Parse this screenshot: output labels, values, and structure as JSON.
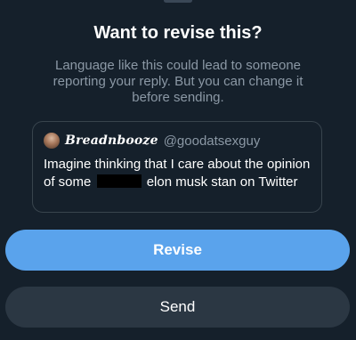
{
  "dialog": {
    "title": "Want to revise this?",
    "description": "Language like this could lead to someone reporting your reply. But you can change it before sending."
  },
  "reply": {
    "display_name": "Breadnbooze",
    "handle": "@goodatsexguy",
    "text_before_redaction": "Imagine thinking that I care about the opinion of some",
    "text_after_redaction": "elon musk stan on Twitter"
  },
  "actions": {
    "revise_label": "Revise",
    "send_label": "Send"
  },
  "colors": {
    "background": "#15202b",
    "accent": "#5aa3ec",
    "secondary_button": "#2b3743",
    "muted_text": "#8b98a5"
  }
}
